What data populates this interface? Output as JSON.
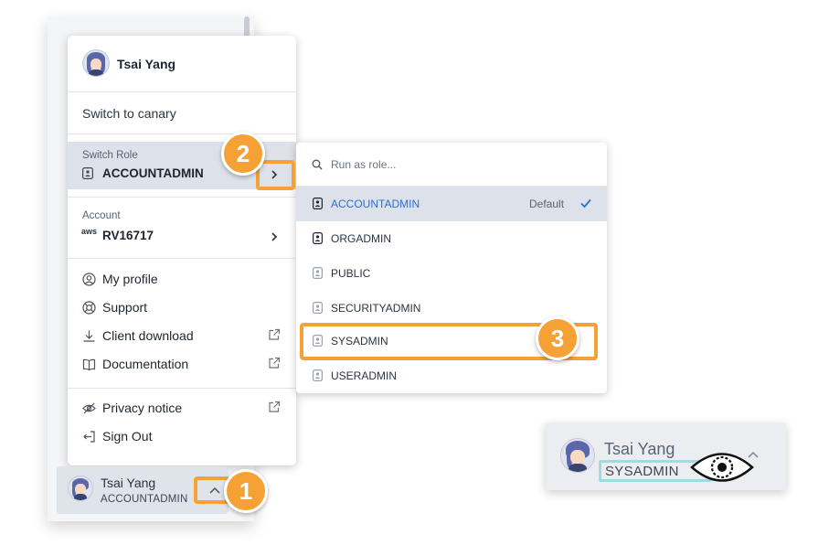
{
  "user": {
    "name": "Tsai Yang",
    "current_role": "ACCOUNTADMIN"
  },
  "menu": {
    "switch_to_canary": "Switch to canary",
    "switch_role": {
      "label": "Switch Role",
      "value": "ACCOUNTADMIN"
    },
    "account": {
      "label": "Account",
      "value": "RV16717",
      "provider_mark": "aws"
    },
    "items": [
      {
        "label": "My profile",
        "icon": "user-circle-icon",
        "external": false
      },
      {
        "label": "Support",
        "icon": "lifebuoy-icon",
        "external": false
      },
      {
        "label": "Client download",
        "icon": "download-icon",
        "external": true
      },
      {
        "label": "Documentation",
        "icon": "book-icon",
        "external": true
      }
    ],
    "items2": [
      {
        "label": "Privacy notice",
        "icon": "eye-off-icon",
        "external": true
      },
      {
        "label": "Sign Out",
        "icon": "sign-out-icon",
        "external": false
      }
    ]
  },
  "role_menu": {
    "search_placeholder": "Run as role...",
    "default_label": "Default",
    "roles": [
      "ACCOUNTADMIN",
      "ORGADMIN",
      "PUBLIC",
      "SECURITYADMIN",
      "SYSADMIN",
      "USERADMIN"
    ],
    "selected": "ACCOUNTADMIN"
  },
  "callouts": [
    "1",
    "2",
    "3"
  ],
  "inset": {
    "name": "Tsai Yang",
    "role": "SYSADMIN"
  },
  "colors": {
    "accent": "#f5a135",
    "selected_text": "#2a6fd6",
    "highlight_cyan": "#9fdbe1"
  }
}
